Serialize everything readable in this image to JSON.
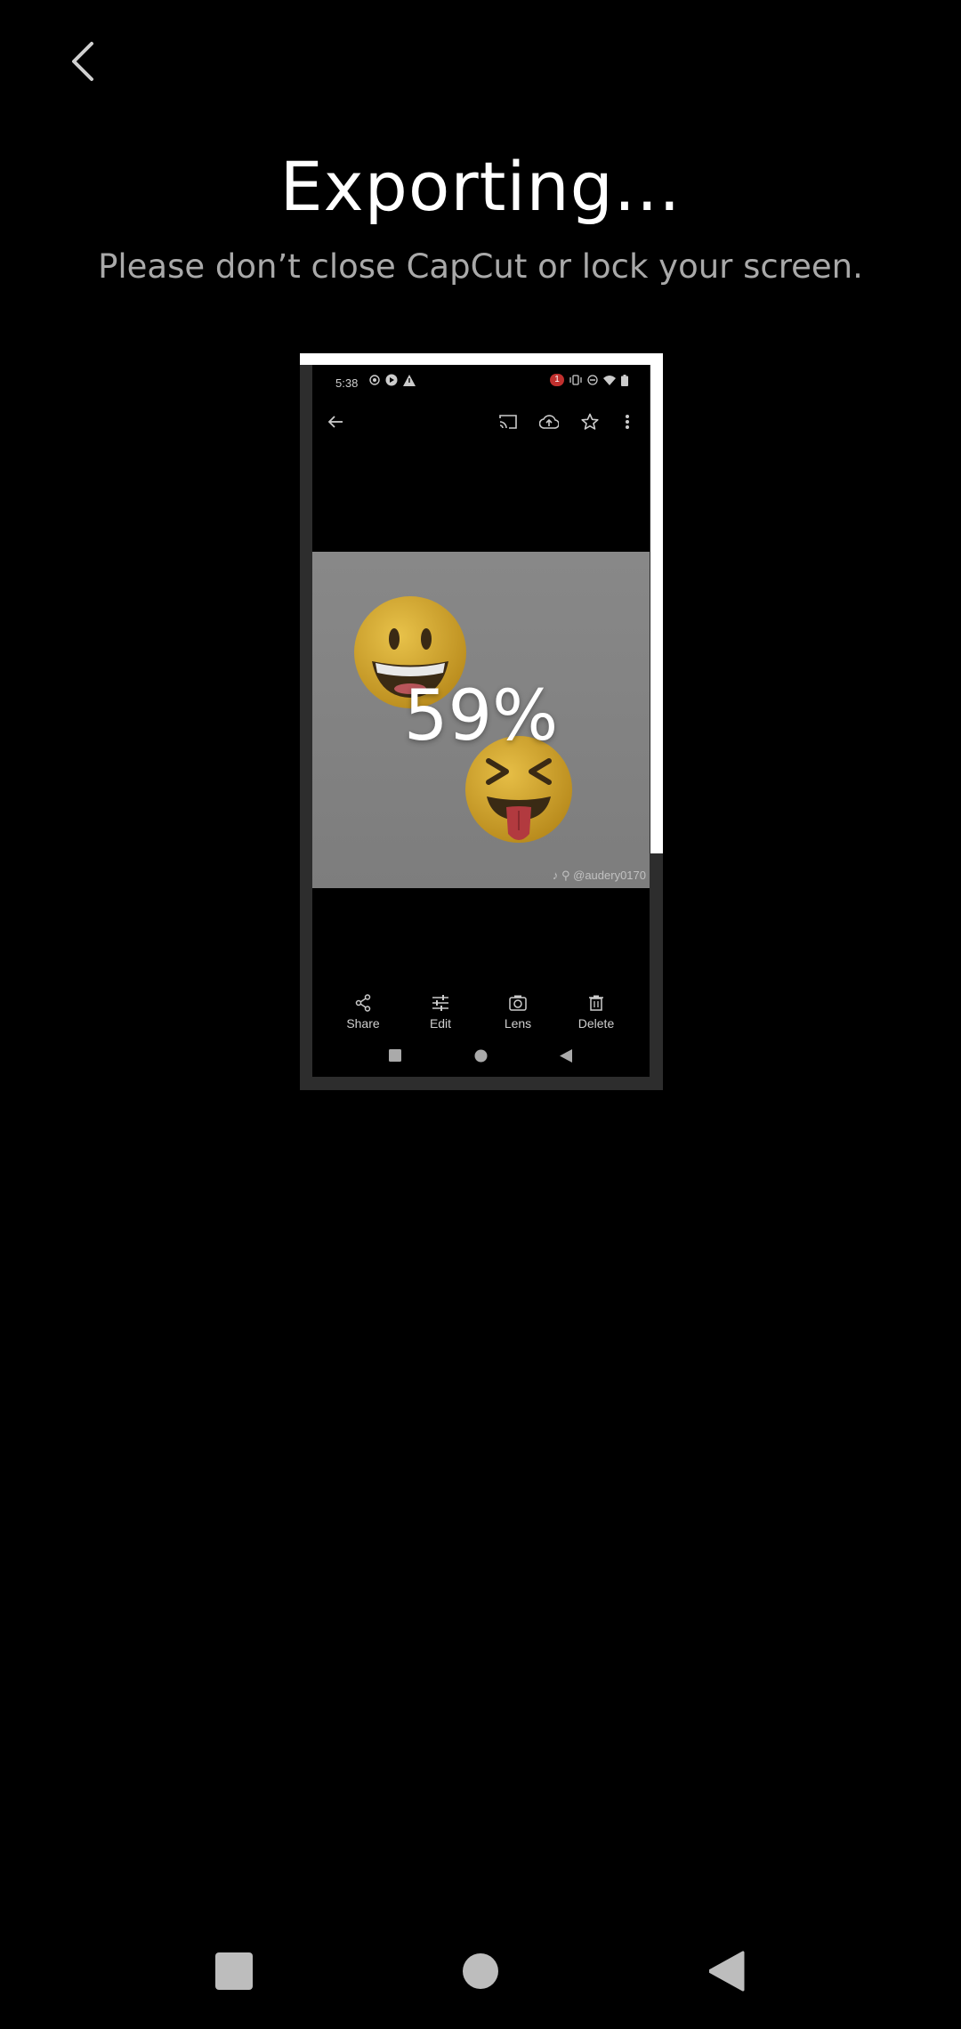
{
  "header": {
    "title": "Exporting...",
    "subtitle": "Please don’t close CapCut or lock your screen."
  },
  "export": {
    "progress_percent": 59,
    "progress_label": "59%"
  },
  "preview": {
    "status_bar": {
      "time": "5:38",
      "notification_count": "1"
    },
    "watermark": "@audery0170",
    "actions": [
      {
        "label": "Share",
        "icon": "share-icon"
      },
      {
        "label": "Edit",
        "icon": "sliders-icon"
      },
      {
        "label": "Lens",
        "icon": "lens-icon"
      },
      {
        "label": "Delete",
        "icon": "trash-icon"
      }
    ]
  },
  "colors": {
    "background": "#000000",
    "progress": "#ffffff",
    "track": "#2d2d2d",
    "subtitle": "#a9a9a9"
  },
  "icons": {
    "back": "chevron-left-icon",
    "nav_recent": "square-icon",
    "nav_home": "circle-icon",
    "nav_back": "triangle-back-icon"
  }
}
